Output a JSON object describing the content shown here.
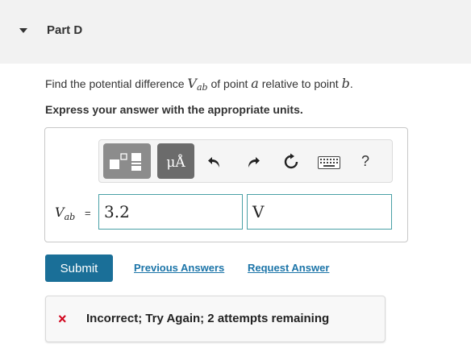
{
  "part": {
    "title": "Part D"
  },
  "question": {
    "prefix": "Find the potential difference ",
    "var_main": "V",
    "var_sub": "ab",
    "middle": " of point ",
    "point_a": "a",
    "suffix_mid": " relative to point ",
    "point_b": "b",
    "suffix": "."
  },
  "instruction": "Express your answer with the appropriate units.",
  "toolbar": {
    "units_label": "μÅ",
    "undo_icon": "undo-arrow",
    "redo_icon": "redo-arrow",
    "reset_icon": "reset-circle-arrow",
    "keyboard_icon": "keyboard",
    "help_label": "?"
  },
  "answer": {
    "var_main": "V",
    "var_sub": "ab",
    "equals": "=",
    "value": "3.2",
    "unit": "V"
  },
  "actions": {
    "submit": "Submit",
    "previous": "Previous Answers",
    "request": "Request Answer"
  },
  "feedback": {
    "icon": "×",
    "message": "Incorrect; Try Again; 2 attempts remaining"
  },
  "colors": {
    "submit_bg": "#1a6f98",
    "link": "#1b74a8",
    "error": "#d0021b",
    "input_border": "#4aa0a6"
  }
}
